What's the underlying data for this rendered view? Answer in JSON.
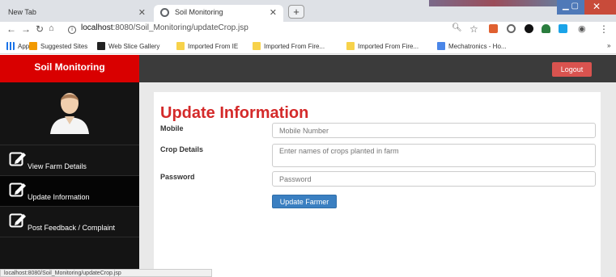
{
  "browser": {
    "tabs": [
      {
        "title": "New Tab"
      },
      {
        "title": "Soil Monitoring"
      }
    ],
    "new_tab_glyph": "+",
    "url": {
      "host": "localhost",
      "path": ":8080/Soil_Monitoring/updateCrop.jsp"
    },
    "bookmarks": [
      {
        "label": "Apps",
        "icon": "apps-grid-icon",
        "color": "#1a73e8"
      },
      {
        "label": "Suggested Sites",
        "icon": "suggested-sites-icon",
        "color": "#f29900"
      },
      {
        "label": "Web Slice Gallery",
        "icon": "web-slice-icon",
        "color": "#222222"
      },
      {
        "label": "Imported From IE",
        "icon": "folder-icon",
        "color": "#f7d24a"
      },
      {
        "label": "Imported From Fire...",
        "icon": "folder-icon",
        "color": "#f7d24a"
      },
      {
        "label": "Imported From Fire...",
        "icon": "folder-icon",
        "color": "#f7d24a"
      },
      {
        "label": "Mechatronics - Ho...",
        "icon": "site-icon",
        "color": "#4a86e8"
      }
    ],
    "status_url": "localhost:8080/Soil_Monitoring/updateCrop.jsp"
  },
  "app": {
    "brand": "Soil Monitoring",
    "logout_label": "Logout",
    "sidebar": {
      "items": [
        {
          "label": "View Farm Details",
          "icon": "edit-icon"
        },
        {
          "label": "Update Information",
          "icon": "edit-icon",
          "active": true
        },
        {
          "label": "Post Feedback / Complaint",
          "icon": "edit-icon"
        }
      ]
    },
    "form": {
      "title": "Update Information",
      "mobile": {
        "label": "Mobile",
        "placeholder": "Mobile Number"
      },
      "crops": {
        "label": "Crop Details",
        "placeholder": "Enter names of crops planted in farm"
      },
      "password": {
        "label": "Password",
        "placeholder": "Password"
      },
      "submit_label": "Update Farmer"
    }
  },
  "colors": {
    "brand_red": "#d90000",
    "heading_red": "#d42a2a",
    "logout_red": "#d9534f",
    "primary_blue": "#3a7fc1",
    "sidebar_bg": "#141414"
  }
}
